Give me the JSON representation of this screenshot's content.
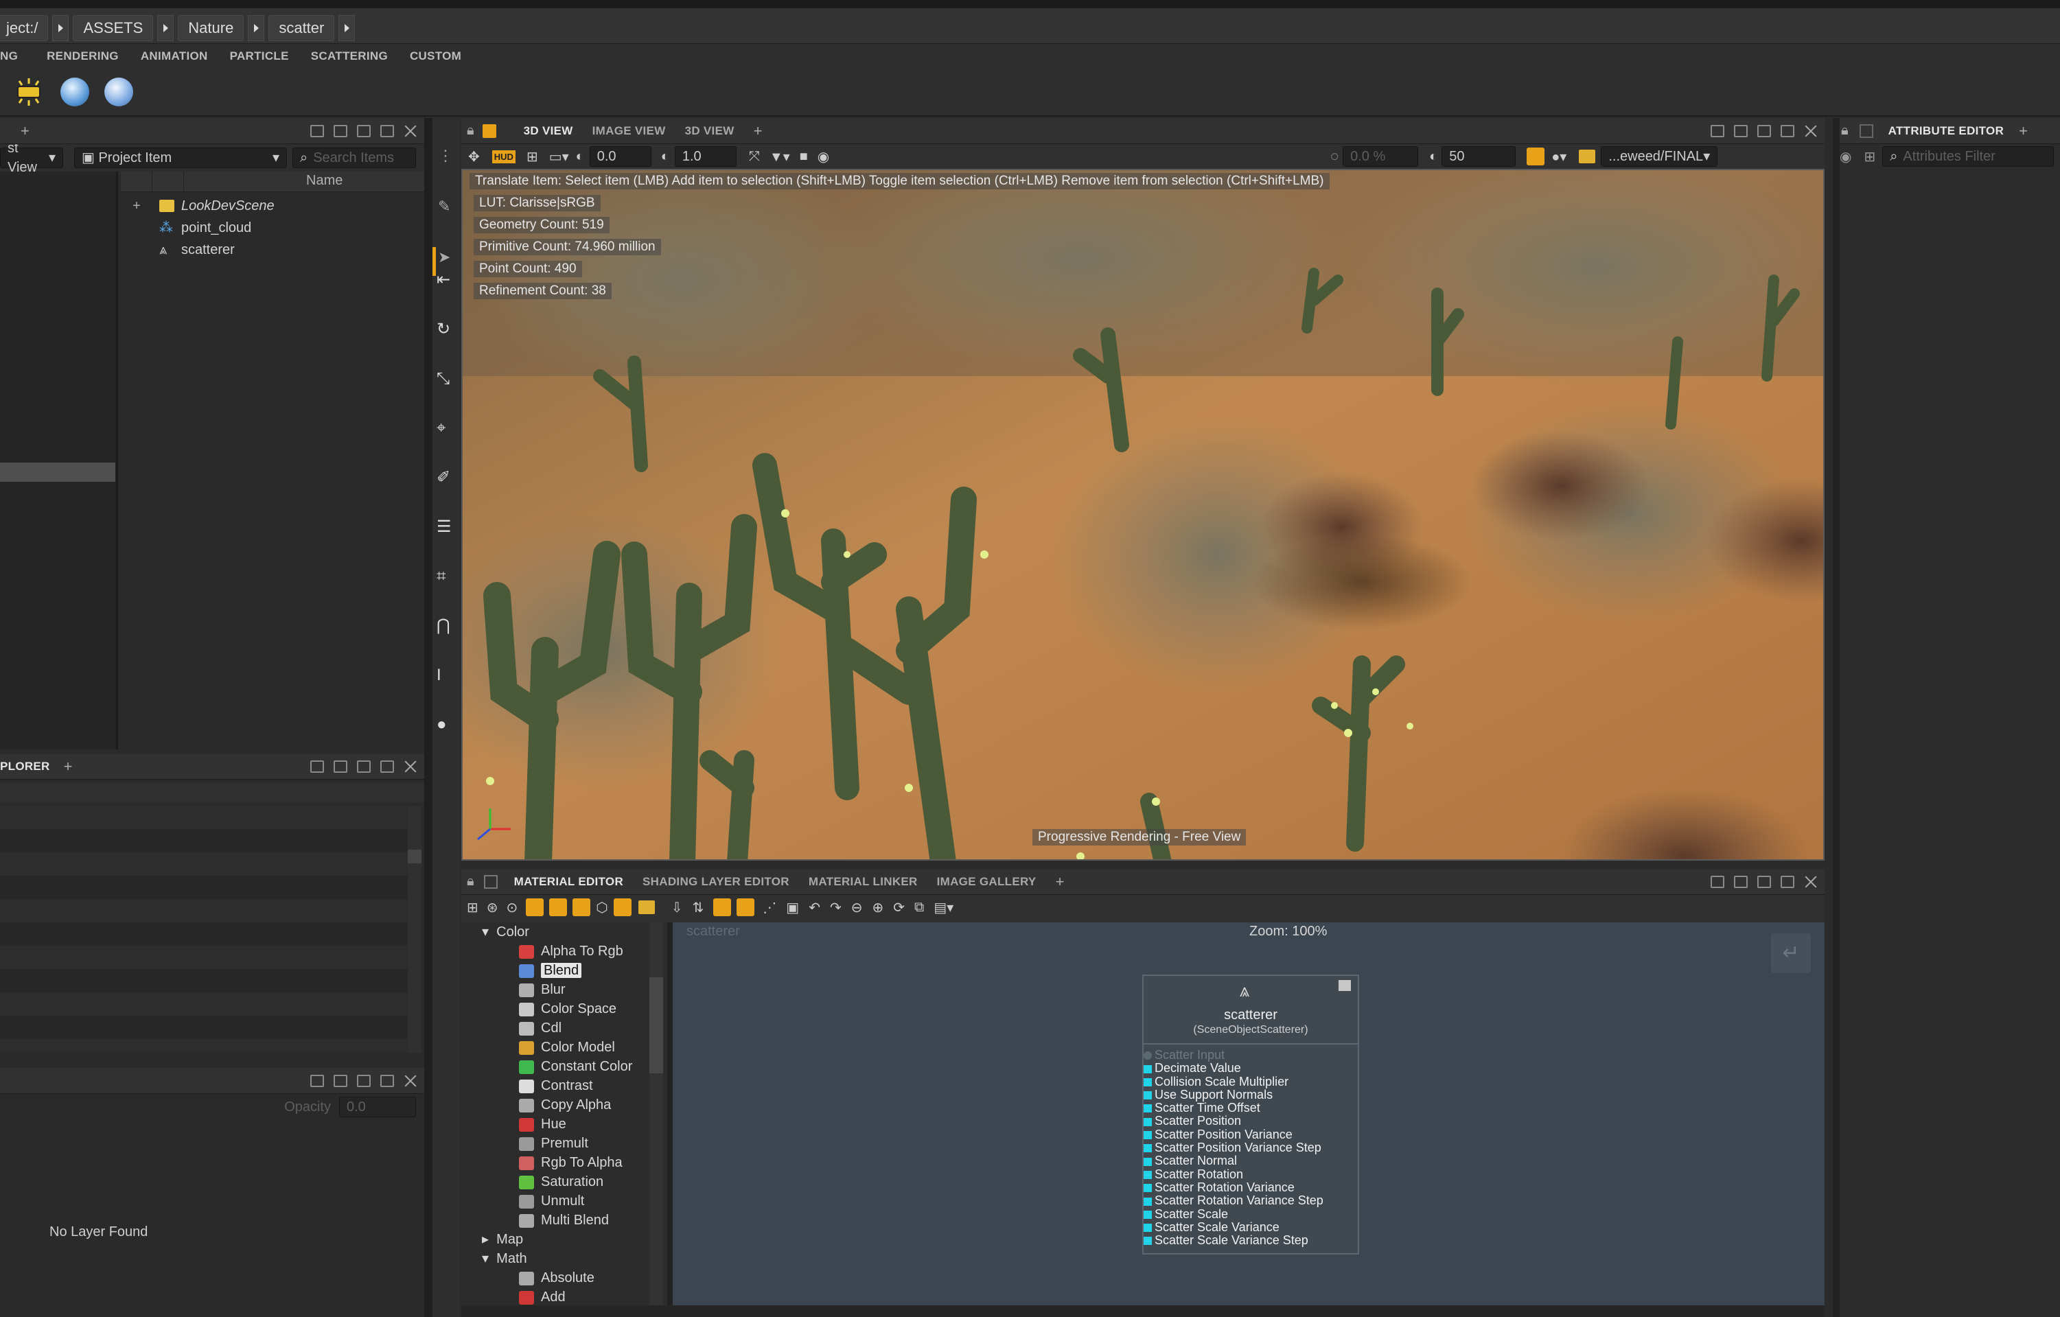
{
  "breadcrumb": {
    "items": [
      "ject:/",
      "ASSETS",
      "Nature",
      "scatter"
    ]
  },
  "shelf": {
    "tabs": [
      "NG",
      "RENDERING",
      "ANIMATION",
      "PARTICLE",
      "SCATTERING",
      "CUSTOM"
    ]
  },
  "project": {
    "add_tab": "+",
    "view_dropdown": "st View",
    "item_dropdown": "Project Item",
    "search_placeholder": "Search Items",
    "column_name": "Name",
    "items": [
      "LookDevScene",
      "point_cloud",
      "scatterer"
    ]
  },
  "explorer": {
    "tab": "PLORER",
    "add_tab": "+"
  },
  "layers": {
    "opacity_label": "Opacity",
    "opacity_value": "0.0",
    "empty_text": "No Layer Found"
  },
  "viewport": {
    "tabs": [
      "3D VIEW",
      "IMAGE VIEW",
      "3D VIEW"
    ],
    "add_tab": "+",
    "toolbar": {
      "value1": "0.0",
      "value2": "1.0",
      "percent": "0.0 %",
      "samples": "50",
      "layer_path": "...eweed/FINAL"
    },
    "hud_help": "Translate Item: Select item (LMB)  Add item to selection (Shift+LMB)  Toggle item selection (Ctrl+LMB)  Remove item from selection (Ctrl+Shift+LMB)",
    "hud_lines": [
      "LUT: Clarisse|sRGB",
      "Geometry Count: 519",
      "Primitive Count: 74.960 million",
      "Point Count: 490",
      "Refinement Count: 38"
    ],
    "status": "Progressive Rendering - Free View"
  },
  "material_editor": {
    "tabs": [
      "MATERIAL EDITOR",
      "SHADING LAYER EDITOR",
      "MATERIAL LINKER",
      "IMAGE GALLERY"
    ],
    "add_tab": "+",
    "context_label": "scatterer",
    "zoom": "Zoom: 100%",
    "library": {
      "groups": [
        {
          "label": "Color",
          "expanded": true,
          "items": [
            "Alpha To Rgb",
            "Blend",
            "Blur",
            "Color Space",
            "Cdl",
            "Color Model",
            "Constant Color",
            "Contrast",
            "Copy Alpha",
            "Hue",
            "Premult",
            "Rgb To Alpha",
            "Saturation",
            "Unmult",
            "Multi Blend"
          ]
        },
        {
          "label": "Map",
          "expanded": false,
          "items": []
        },
        {
          "label": "Math",
          "expanded": true,
          "items": [
            "Absolute",
            "Add"
          ]
        }
      ],
      "selected": "Blend"
    },
    "node": {
      "title": "scatterer",
      "subtitle": "(SceneObjectScatterer)",
      "input_port": "Scatter Input",
      "ports": [
        "Decimate Value",
        "Collision Scale Multiplier",
        "Use Support Normals",
        "Scatter Time Offset",
        "Scatter Position",
        "Scatter Position Variance",
        "Scatter Position Variance Step",
        "Scatter Normal",
        "Scatter Rotation",
        "Scatter Rotation Variance",
        "Scatter Rotation Variance Step",
        "Scatter Scale",
        "Scatter Scale Variance",
        "Scatter Scale Variance Step"
      ]
    }
  },
  "attribute_editor": {
    "tab": "ATTRIBUTE EDITOR",
    "add_tab": "+",
    "filter_placeholder": "Attributes Filter"
  },
  "colors": {
    "accent_orange": "#e8a21a",
    "port_cyan": "#21d3e8",
    "panel_bg": "#2b2b2b",
    "node_bg": "#404850"
  }
}
